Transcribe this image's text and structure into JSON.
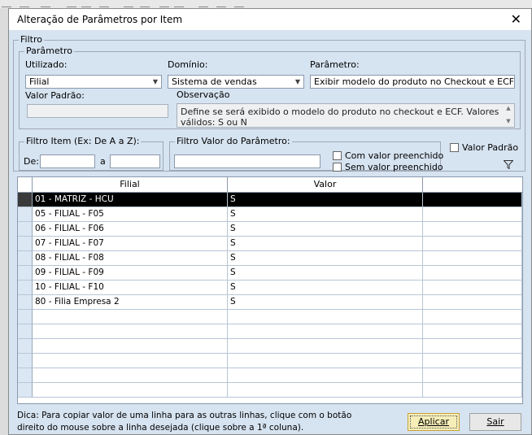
{
  "window": {
    "title": "Alteração de Parâmetros por Item"
  },
  "filtro": {
    "legend": "Filtro",
    "parametro": {
      "legend": "Parâmetro",
      "utilizado_label": "Utilizado:",
      "utilizado_value": "Filial",
      "dominio_label": "Domínio:",
      "dominio_value": "Sistema de vendas",
      "parametro_label": "Parâmetro:",
      "parametro_value": "Exibir modelo do produto no Checkout e ECF",
      "valor_padrao_label": "Valor Padrão:",
      "valor_padrao_value": "",
      "observacao_label": "Observação",
      "observacao_value": "Define se será exibido o modelo do produto no checkout e ECF. Valores válidos: S ou N"
    },
    "filtro_item": {
      "legend": "Filtro Item (Ex: De A a Z):",
      "de_label": "De:",
      "de_value": "",
      "a_label": "a",
      "a_value": ""
    },
    "filtro_valor": {
      "legend": "Filtro Valor do Parâmetro:",
      "value": "",
      "com_valor": "Com valor preenchido",
      "sem_valor": "Sem valor preenchido"
    },
    "valor_padrao_check": "Valor Padrão"
  },
  "grid": {
    "columns": [
      "Filial",
      "Valor"
    ],
    "rows": [
      {
        "filial": "01 - MATRIZ - HCU",
        "valor": "S",
        "selected": true
      },
      {
        "filial": "05 - FILIAL - F05",
        "valor": "S"
      },
      {
        "filial": "06 - FILIAL - F06",
        "valor": "S"
      },
      {
        "filial": "07 - FILIAL - F07",
        "valor": "S"
      },
      {
        "filial": "08 - FILIAL - F08",
        "valor": "S"
      },
      {
        "filial": "09 - FILIAL - F09",
        "valor": "S"
      },
      {
        "filial": "10 - FILIAL - F10",
        "valor": "S"
      },
      {
        "filial": "80 - Filia Empresa 2",
        "valor": "S"
      },
      {
        "filial": "",
        "valor": ""
      },
      {
        "filial": "",
        "valor": ""
      },
      {
        "filial": "",
        "valor": ""
      },
      {
        "filial": "",
        "valor": ""
      },
      {
        "filial": "",
        "valor": ""
      },
      {
        "filial": "",
        "valor": ""
      }
    ]
  },
  "footer": {
    "tip_line1": "Dica: Para copiar valor de uma linha para as outras linhas, clique com o botão",
    "tip_line2": "direito do mouse sobre a linha desejada (clique sobre a 1ª coluna).",
    "aplicar": "Aplicar",
    "sair": "Sair"
  }
}
